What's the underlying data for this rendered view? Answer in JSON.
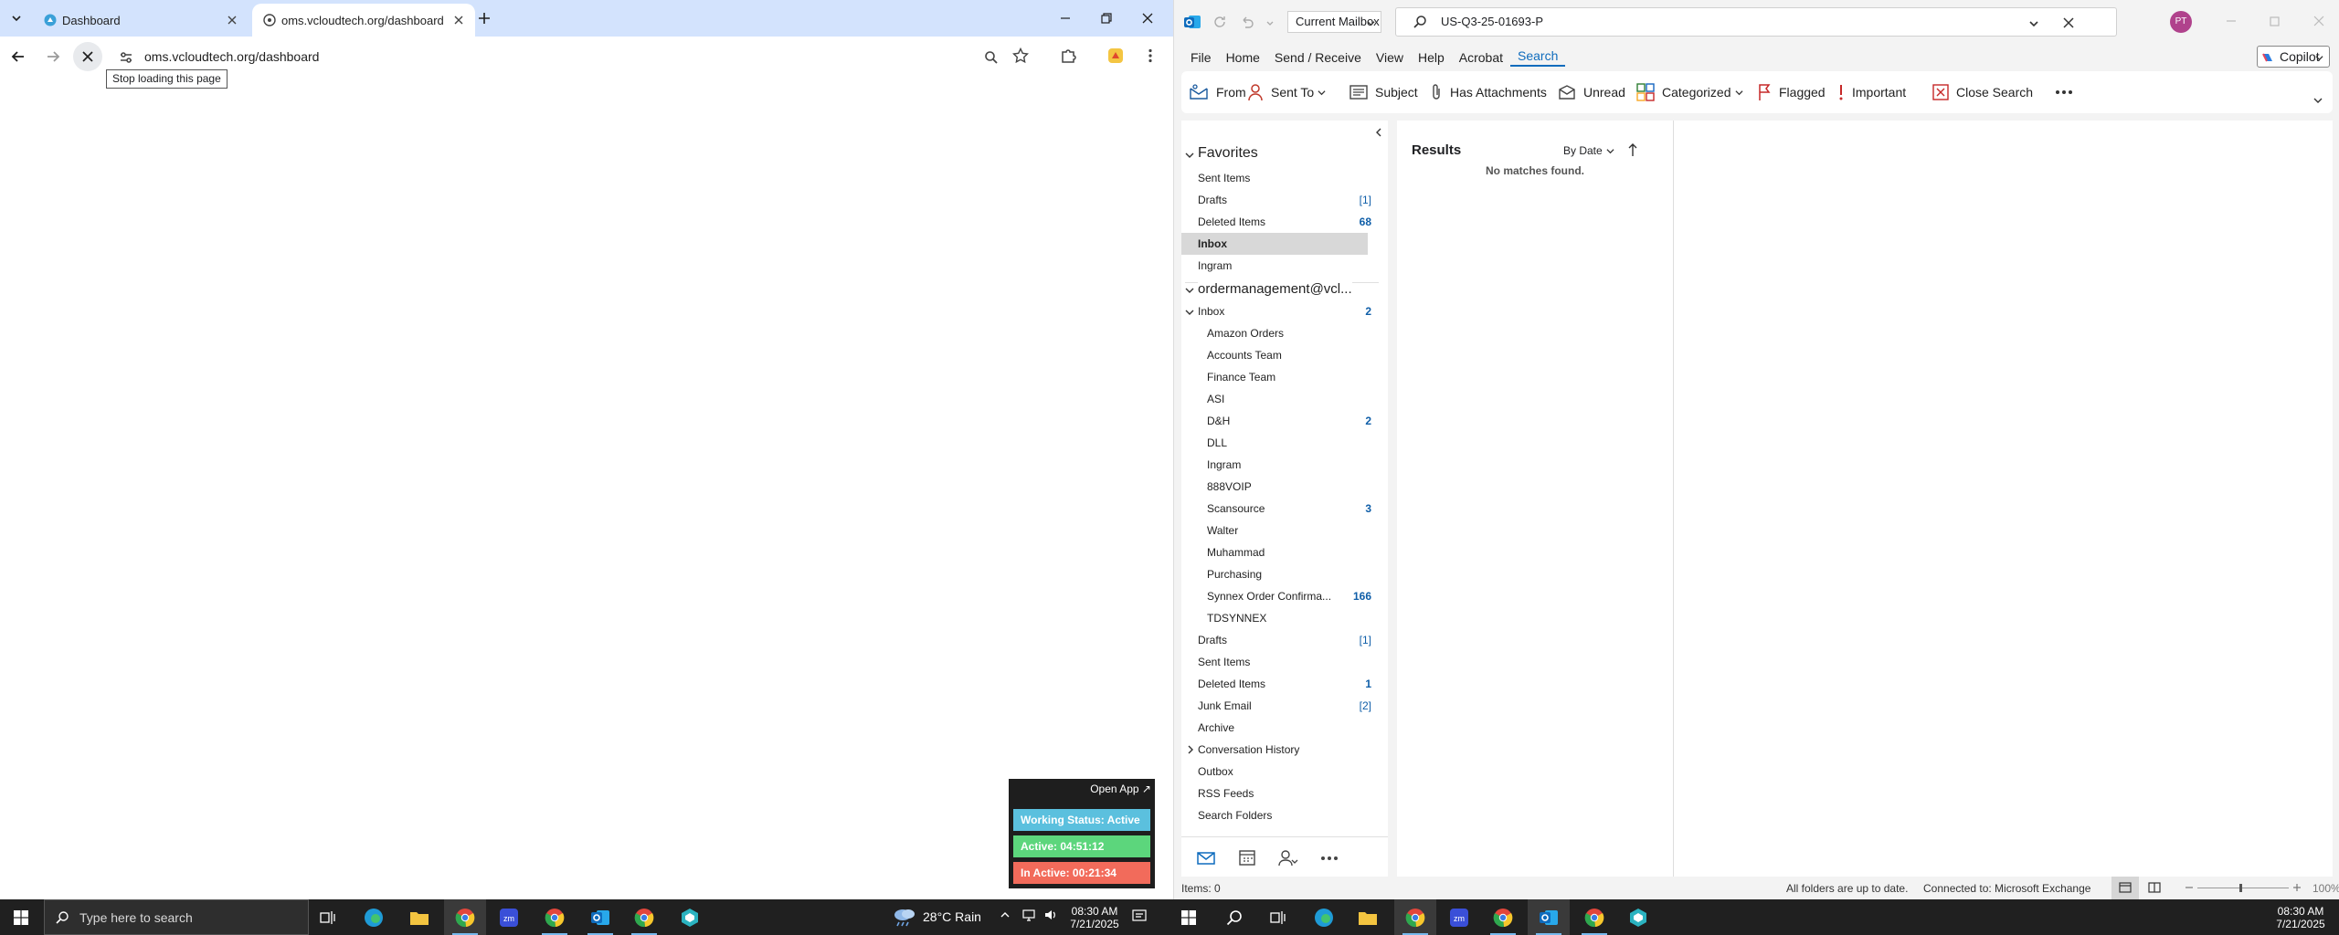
{
  "browser": {
    "tabs": [
      {
        "title": "Dashboard"
      },
      {
        "title": "oms.vcloudtech.org/dashboard"
      }
    ],
    "url": "oms.vcloudtech.org/dashboard",
    "tooltip": "Stop loading this page"
  },
  "tracker": {
    "open_app": "Open App ↗",
    "status": "Working Status: Active",
    "active": "Active: 04:51:12",
    "inactive": "In Active: 00:21:34"
  },
  "outlook": {
    "scope": "Current Mailbox",
    "search_query": "US-Q3-25-01693-P",
    "avatar_initials": "PT",
    "copilot": "Copilot",
    "menu": [
      "File",
      "Home",
      "Send / Receive",
      "View",
      "Help",
      "Acrobat",
      "Search"
    ],
    "ribbon": [
      "From",
      "Sent To",
      "Subject",
      "Has Attachments",
      "Unread",
      "Categorized",
      "Flagged",
      "Important",
      "Close Search"
    ],
    "favorites_header": "Favorites",
    "favorites": [
      {
        "label": "Sent Items",
        "count": ""
      },
      {
        "label": "Drafts",
        "count": "[1]"
      },
      {
        "label": "Deleted Items",
        "count": "68"
      },
      {
        "label": "Inbox",
        "count": ""
      },
      {
        "label": "Ingram",
        "count": ""
      }
    ],
    "account": "ordermanagement@vcl...",
    "inbox": {
      "label": "Inbox",
      "count": "2"
    },
    "subfolders": [
      {
        "label": "Amazon Orders",
        "count": ""
      },
      {
        "label": "Accounts Team",
        "count": ""
      },
      {
        "label": "Finance Team",
        "count": ""
      },
      {
        "label": "ASI",
        "count": ""
      },
      {
        "label": "D&H",
        "count": "2"
      },
      {
        "label": "DLL",
        "count": ""
      },
      {
        "label": "Ingram",
        "count": ""
      },
      {
        "label": "888VOIP",
        "count": ""
      },
      {
        "label": "Scansource",
        "count": "3"
      },
      {
        "label": "Walter",
        "count": ""
      },
      {
        "label": "Muhammad",
        "count": ""
      },
      {
        "label": "Purchasing",
        "count": ""
      },
      {
        "label": "Synnex Order Confirma...",
        "count": "166"
      },
      {
        "label": "TDSYNNEX",
        "count": ""
      }
    ],
    "folders": [
      {
        "label": "Drafts",
        "count": "[1]"
      },
      {
        "label": "Sent Items",
        "count": ""
      },
      {
        "label": "Deleted Items",
        "count": "1"
      },
      {
        "label": "Junk Email",
        "count": "[2]"
      },
      {
        "label": "Archive",
        "count": ""
      },
      {
        "label": "Conversation History",
        "count": ""
      },
      {
        "label": "Outbox",
        "count": ""
      },
      {
        "label": "RSS Feeds",
        "count": ""
      },
      {
        "label": "Search Folders",
        "count": ""
      }
    ],
    "results_title": "Results",
    "sort_label": "By Date",
    "no_matches": "No matches found.",
    "status_items": "Items: 0",
    "status_sync": "All folders are up to date.",
    "status_conn": "Connected to: Microsoft Exchange",
    "zoom": "100%"
  },
  "taskbar": {
    "search_placeholder": "Type here to search",
    "weather": "28°C  Rain",
    "time": "08:30 AM",
    "date": "7/21/2025",
    "time2": "08:30 AM",
    "date2": "7/21/2025"
  },
  "colors": {
    "accent": "#0f6cbd",
    "tab_bar": "#d3e3fd",
    "taskbar": "#202020",
    "tracker_status": "#5bc0de",
    "tracker_active": "#5cd67c",
    "tracker_inactive": "#f26b5b"
  }
}
